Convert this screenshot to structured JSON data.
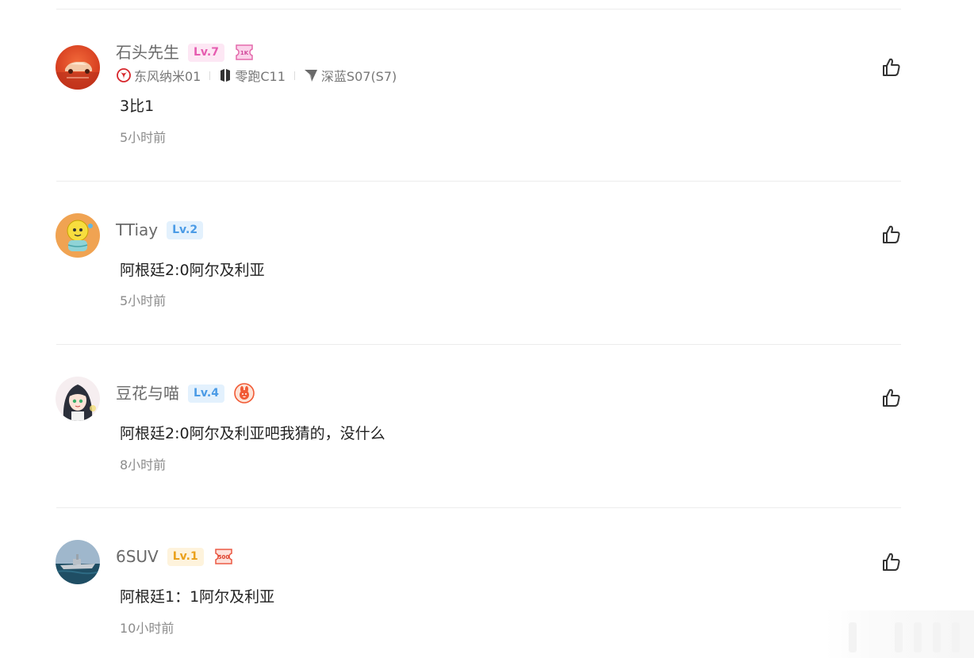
{
  "colors": {
    "level_pink": "#e65cb0",
    "level_blue": "#4b9be6",
    "level_orange": "#eaa11c",
    "divider": "#ececec",
    "username": "#6a6a6a"
  },
  "comments": [
    {
      "username": "石头先生",
      "level": "Lv.7",
      "medal_icon": "1k-ticket-medal-icon",
      "medal_label": "1K",
      "cars": [
        {
          "icon": "dongfeng-logo-icon",
          "label": "东风纳米01"
        },
        {
          "icon": "leapmotor-logo-icon",
          "label": "零跑C11"
        },
        {
          "icon": "deepal-logo-icon",
          "label": "深蓝S07(S7)"
        }
      ],
      "text": "3比1",
      "time": "5小时前",
      "avatar_icon": "red-car-avatar-icon"
    },
    {
      "username": "TTiay",
      "level": "Lv.2",
      "text": "阿根廷2:0阿尔及利亚",
      "time": "5小时前",
      "avatar_icon": "yellow-cartoon-avatar-icon"
    },
    {
      "username": "豆花与喵",
      "level": "Lv.4",
      "medal_icon": "rabbit-medal-icon",
      "text": "阿根廷2:0阿尔及利亚吧我猜的，没什么",
      "time": "8小时前",
      "avatar_icon": "anime-girl-avatar-icon"
    },
    {
      "username": "6SUV",
      "level": "Lv.1",
      "medal_icon": "500-ticket-medal-icon",
      "medal_label": "500",
      "text": "阿根廷1：1阿尔及利亚",
      "time": "10小时前",
      "avatar_icon": "warship-avatar-icon"
    }
  ],
  "like_icon": "thumbs-up-outline-icon"
}
